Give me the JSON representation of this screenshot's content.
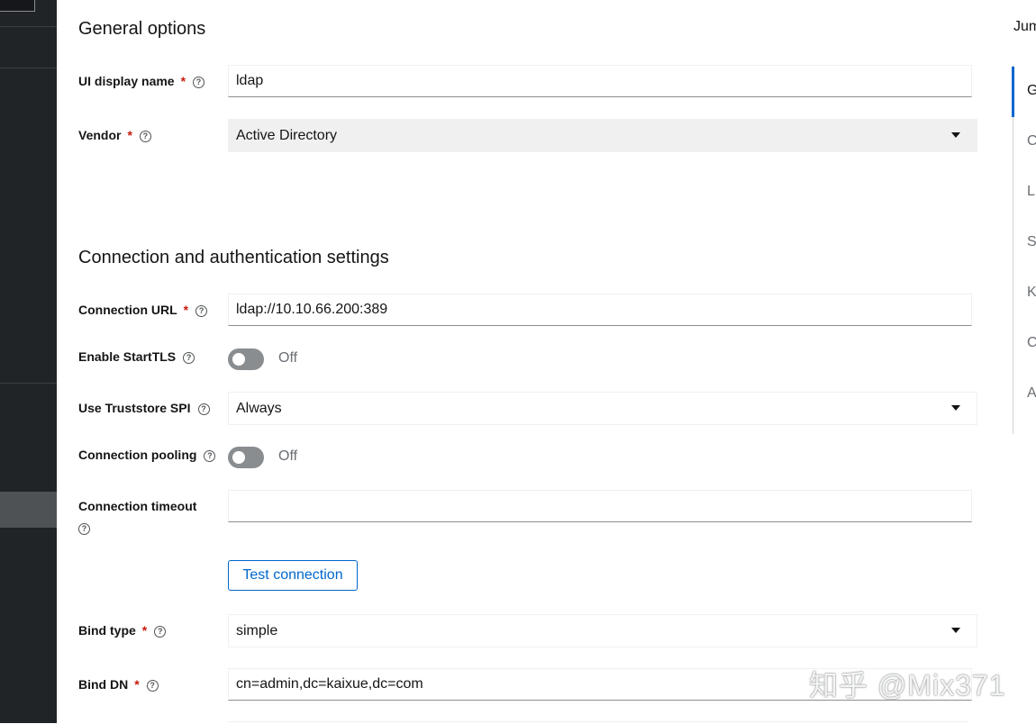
{
  "general": {
    "title": "General options",
    "display_name": {
      "label": "UI display name",
      "required": "*",
      "help": "?",
      "value": "ldap"
    },
    "vendor": {
      "label": "Vendor",
      "required": "*",
      "help": "?",
      "value": "Active Directory"
    }
  },
  "connection": {
    "title": "Connection and authentication settings",
    "url": {
      "label": "Connection URL",
      "required": "*",
      "help": "?",
      "value": "ldap://10.10.66.200:389"
    },
    "starttls": {
      "label": "Enable StartTLS",
      "help": "?",
      "state": "Off"
    },
    "truststore": {
      "label": "Use Truststore SPI",
      "help": "?",
      "value": "Always"
    },
    "pooling": {
      "label": "Connection pooling",
      "help": "?",
      "state": "Off"
    },
    "timeout": {
      "label": "Connection timeout",
      "help": "?",
      "value": ""
    },
    "test_button": "Test connection",
    "bind_type": {
      "label": "Bind type",
      "required": "*",
      "help": "?",
      "value": "simple"
    },
    "bind_dn": {
      "label": "Bind DN",
      "required": "*",
      "help": "?",
      "value": "cn=admin,dc=kaixue,dc=com"
    }
  },
  "jump_links": {
    "title": "Jum",
    "items": [
      "G",
      "C",
      "L",
      "S",
      "K",
      "C",
      "A"
    ]
  },
  "watermark": "知乎 @Mix371",
  "colors": {
    "accent": "#0066cc",
    "required": "#c9190b",
    "sidebar": "#212427"
  }
}
